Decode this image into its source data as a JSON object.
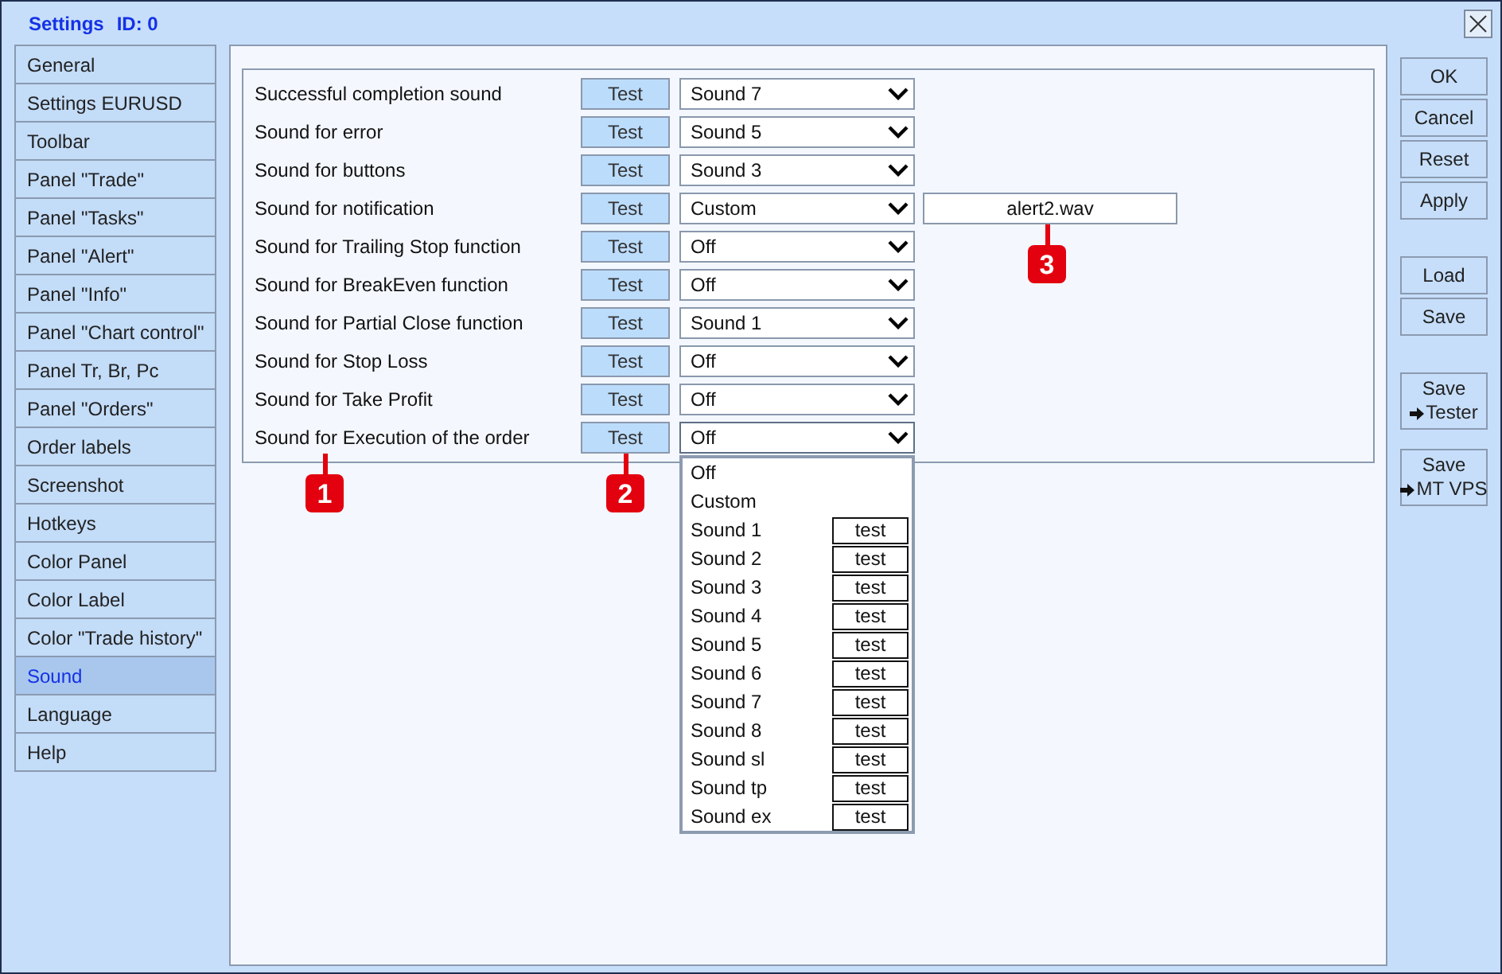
{
  "window": {
    "title": "Settings",
    "id_label": "ID: 0"
  },
  "sidebar": {
    "items": [
      {
        "label": "General",
        "selected": false
      },
      {
        "label": "Settings EURUSD",
        "selected": false
      },
      {
        "label": "Toolbar",
        "selected": false
      },
      {
        "label": "Panel \"Trade\"",
        "selected": false
      },
      {
        "label": "Panel \"Tasks\"",
        "selected": false
      },
      {
        "label": "Panel \"Alert\"",
        "selected": false
      },
      {
        "label": "Panel \"Info\"",
        "selected": false
      },
      {
        "label": "Panel \"Chart control\"",
        "selected": false
      },
      {
        "label": "Panel Tr, Br, Pc",
        "selected": false
      },
      {
        "label": "Panel \"Orders\"",
        "selected": false
      },
      {
        "label": "Order labels",
        "selected": false
      },
      {
        "label": "Screenshot",
        "selected": false
      },
      {
        "label": "Hotkeys",
        "selected": false
      },
      {
        "label": "Color Panel",
        "selected": false
      },
      {
        "label": "Color Label",
        "selected": false
      },
      {
        "label": "Color \"Trade history\"",
        "selected": false
      },
      {
        "label": "Sound",
        "selected": true
      },
      {
        "label": "Language",
        "selected": false
      },
      {
        "label": "Help",
        "selected": false
      }
    ]
  },
  "sound_settings": {
    "rows": [
      {
        "label": "Successful completion sound",
        "test_button": "Test",
        "select": {
          "value": "Sound 7",
          "expanded": false
        }
      },
      {
        "label": "Sound for error",
        "test_button": "Test",
        "select": {
          "value": "Sound 5",
          "expanded": false
        }
      },
      {
        "label": "Sound for buttons",
        "test_button": "Test",
        "select": {
          "value": "Sound 3",
          "expanded": false
        }
      },
      {
        "label": "Sound for notification",
        "test_button": "Test",
        "select": {
          "value": "Custom",
          "expanded": false
        },
        "custom_file": {
          "value": "alert2.wav",
          "callout": "3"
        }
      },
      {
        "label": "Sound for Trailing Stop function",
        "test_button": "Test",
        "select": {
          "value": "Off",
          "expanded": false
        }
      },
      {
        "label": "Sound for BreakEven function",
        "test_button": "Test",
        "select": {
          "value": "Off",
          "expanded": false
        }
      },
      {
        "label": "Sound for Partial Close function",
        "test_button": "Test",
        "select": {
          "value": "Sound 1",
          "expanded": false
        }
      },
      {
        "label": "Sound for Stop Loss",
        "test_button": "Test",
        "select": {
          "value": "Off",
          "expanded": false
        }
      },
      {
        "label": "Sound for Take Profit",
        "test_button": "Test",
        "select": {
          "value": "Off",
          "expanded": false
        }
      },
      {
        "label": "Sound for Execution of the order",
        "label_callout": "1",
        "test_button": "Test",
        "test_callout": "2",
        "select": {
          "value": "Off",
          "expanded": true,
          "options": [
            {
              "label": "Off"
            },
            {
              "label": "Custom"
            },
            {
              "label": "Sound 1",
              "test": "test"
            },
            {
              "label": "Sound 2",
              "test": "test"
            },
            {
              "label": "Sound 3",
              "test": "test"
            },
            {
              "label": "Sound 4",
              "test": "test"
            },
            {
              "label": "Sound 5",
              "test": "test"
            },
            {
              "label": "Sound 6",
              "test": "test"
            },
            {
              "label": "Sound 7",
              "test": "test"
            },
            {
              "label": "Sound 8",
              "test": "test"
            },
            {
              "label": "Sound sl",
              "test": "test"
            },
            {
              "label": "Sound tp",
              "test": "test"
            },
            {
              "label": "Sound ex",
              "test": "test"
            }
          ]
        }
      }
    ]
  },
  "side_buttons": [
    {
      "buttons": [
        {
          "label": "OK"
        },
        {
          "label": "Cancel"
        },
        {
          "label": "Reset"
        },
        {
          "label": "Apply"
        }
      ]
    },
    {
      "buttons": [
        {
          "label": "Load"
        },
        {
          "label": "Save"
        }
      ]
    },
    {
      "buttons": [
        {
          "label": "Save",
          "target": "Tester"
        },
        {
          "label": "Save",
          "target": "MT VPS"
        }
      ]
    }
  ]
}
